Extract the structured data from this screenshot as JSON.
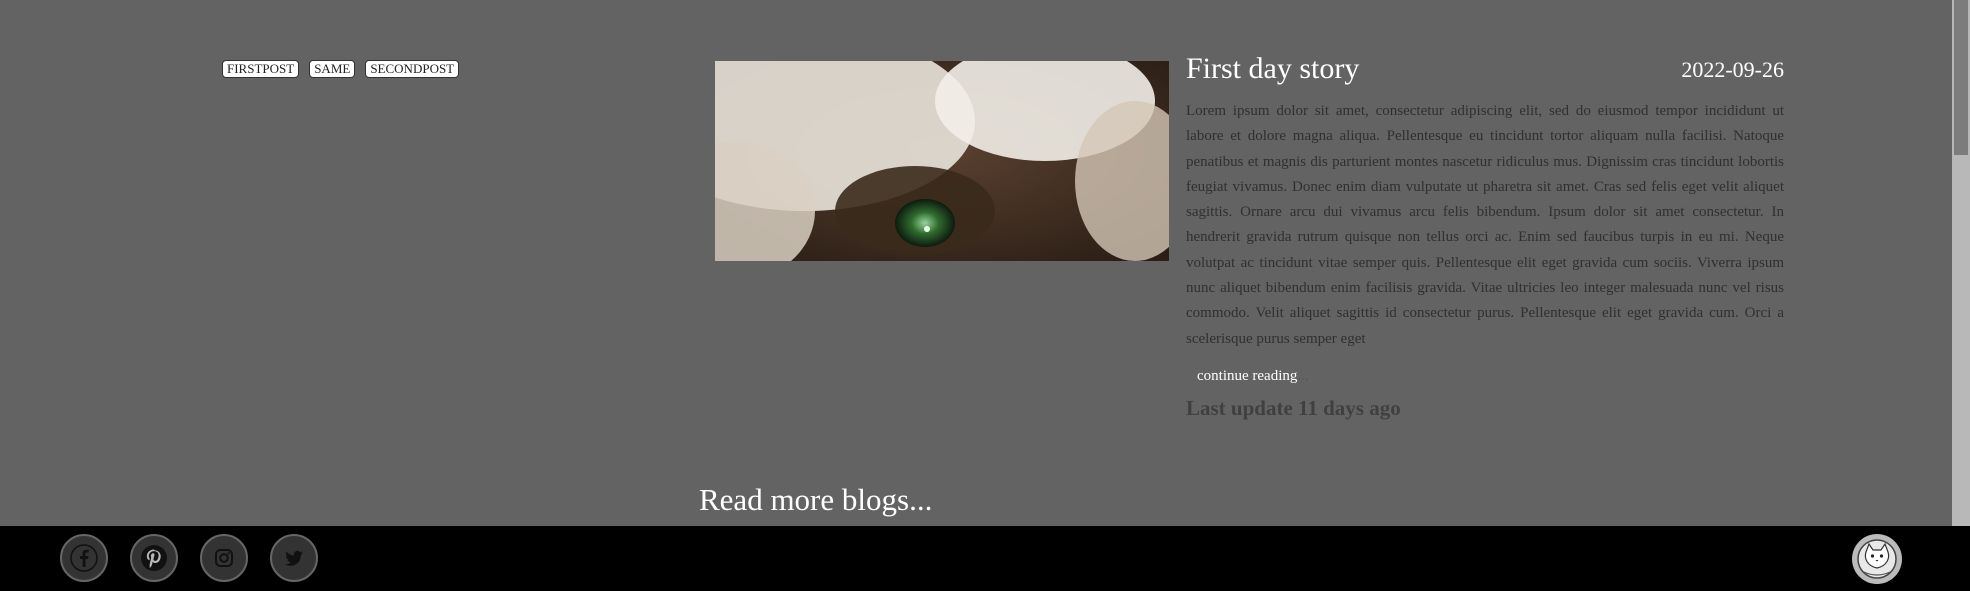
{
  "tags": [
    "FIRSTPOST",
    "SAME",
    "SECONDPOST"
  ],
  "post": {
    "title": "First day story",
    "date": "2022-09-26",
    "body": "Lorem ipsum dolor sit amet, consectetur adipiscing elit, sed do eiusmod tempor incididunt ut labore et dolore magna aliqua. Pellentesque eu tincidunt tortor aliquam nulla facilisi. Natoque penatibus et magnis dis parturient montes nascetur ridiculus mus. Dignissim cras tincidunt lobortis feugiat vivamus. Donec enim diam vulputate ut pharetra sit amet. Cras sed felis eget velit aliquet sagittis. Ornare arcu dui vivamus arcu felis bibendum. Ipsum dolor sit amet consectetur. In hendrerit gravida rutrum quisque non tellus orci ac. Enim sed faucibus turpis in eu mi. Neque volutpat ac tincidunt vitae semper quis. Pellentesque elit eget gravida cum sociis. Viverra ipsum nunc aliquet bibendum enim facilisis gravida. Vitae ultricies leo integer malesuada nunc vel risus commodo. Velit aliquet sagittis id consectetur purus. Pellentesque elit eget gravida cum. Orci a scelerisque purus semper eget",
    "continue_label": "continue reading",
    "continue_suffix": "...",
    "last_update": "Last update 11 days ago"
  },
  "read_more": "Read more blogs...",
  "footer": {
    "social_icons": [
      "facebook-icon",
      "pinterest-icon",
      "instagram-icon",
      "twitter-icon"
    ],
    "logo_icon": "cat-logo-icon"
  },
  "colors": {
    "background": "#636363",
    "footer": "#000000",
    "text_primary": "#ffffff",
    "text_body": "#303030"
  }
}
